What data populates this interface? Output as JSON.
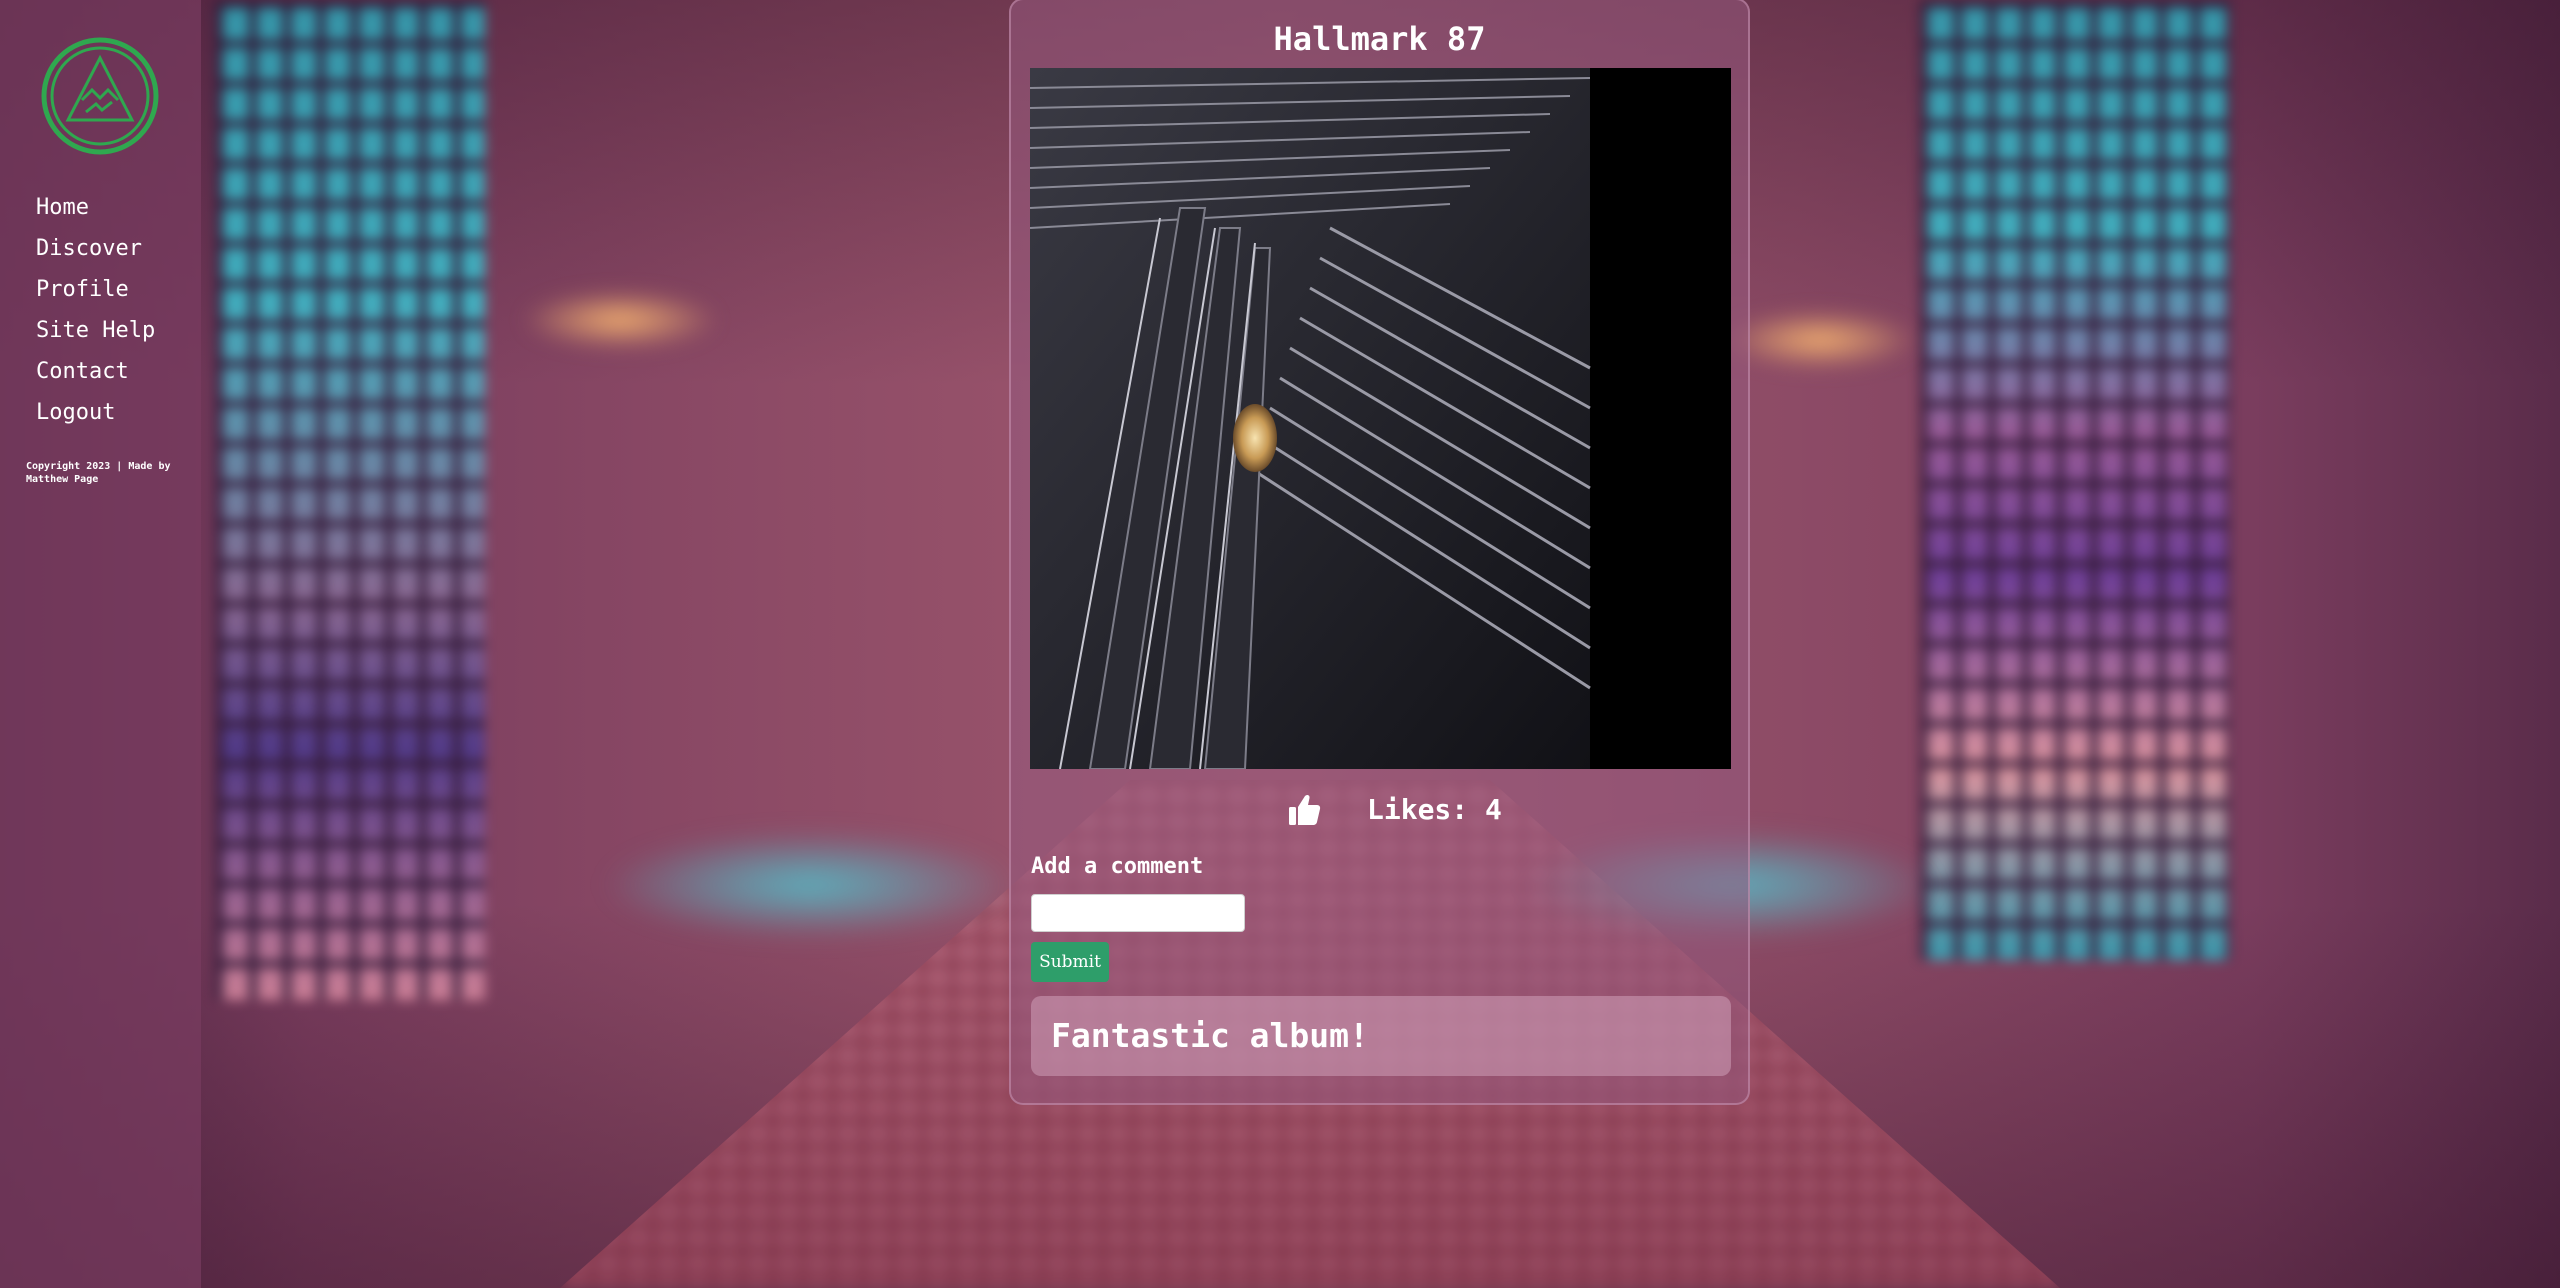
{
  "sidebar": {
    "logo_icon": "triangle-mountain-logo-icon",
    "logo_color": "#2fa84f",
    "nav_items": [
      {
        "label": "Home"
      },
      {
        "label": "Discover"
      },
      {
        "label": "Profile"
      },
      {
        "label": "Site Help"
      },
      {
        "label": "Contact"
      },
      {
        "label": "Logout"
      }
    ],
    "copyright": "Copyright 2023 | Made by Matthew Page"
  },
  "post": {
    "title": "Hallmark 87",
    "like_icon": "thumbs-up-icon",
    "likes_text": "Likes: 4",
    "comment_label": "Add a comment",
    "comment_input_value": "",
    "submit_label": "Submit",
    "submit_color": "#2e9e6a",
    "comments": [
      {
        "text": "Fantastic album!"
      }
    ]
  }
}
